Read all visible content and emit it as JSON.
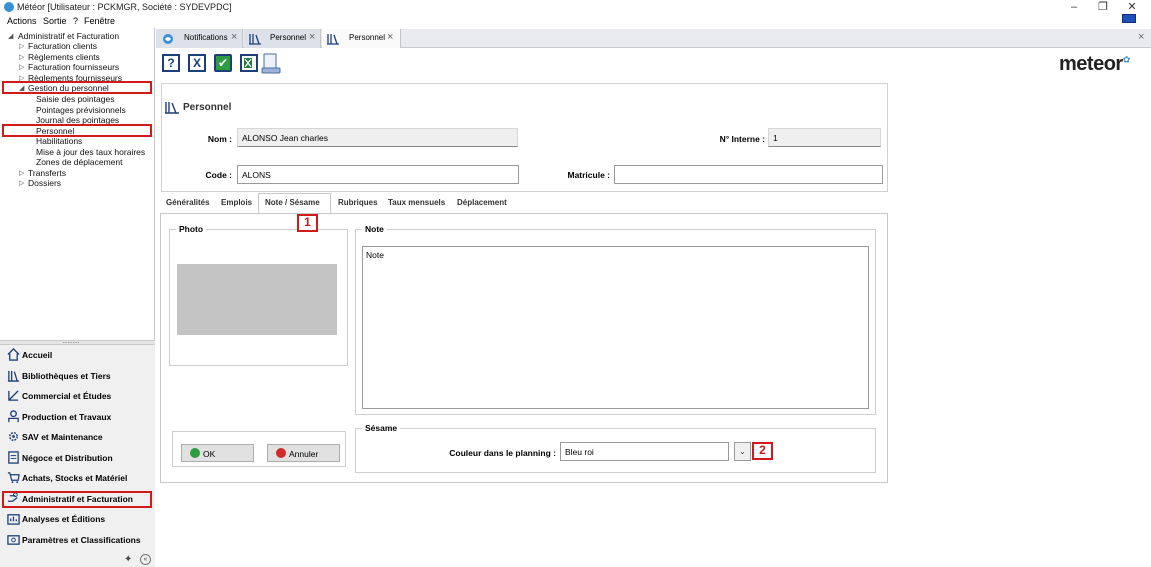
{
  "window": {
    "title": "Météor [Utilisateur : PCKMGR, Société : SYDEVPDC]",
    "minimize_glyph": "–",
    "restore_glyph": "❐",
    "close_glyph": "✕"
  },
  "menu": {
    "items": [
      "Actions",
      "Sortie",
      "?",
      "Fenêtre"
    ]
  },
  "tree": {
    "root": "Administratif et Facturation",
    "children": [
      "Facturation clients",
      "Règlements clients",
      "Facturation fournisseurs",
      "Règlements fournisseurs",
      "Gestion du personnel"
    ],
    "personnel_children": [
      "Saisie des pointages",
      "Pointages prévisionnels",
      "Journal des pointages",
      "Personnel",
      "Habilitations",
      "Mise à jour des taux horaires",
      "Zones de déplacement"
    ],
    "others": [
      "Transferts",
      "Dossiers"
    ]
  },
  "modules": [
    "Accueil",
    "Bibliothèques et Tiers",
    "Commercial et Études",
    "Production et Travaux",
    "SAV et Maintenance",
    "Négoce et Distribution",
    "Achats, Stocks et Matériel",
    "Administratif et Facturation",
    "Analyses et Éditions",
    "Paramètres et Classifications"
  ],
  "doc_tabs": [
    "Notifications",
    "Personnel",
    "Personnel"
  ],
  "toolbar": {
    "help": "?",
    "cancel": "X",
    "validate": "✔"
  },
  "logo": {
    "text": "meteor"
  },
  "form": {
    "section_title": "Personnel",
    "nom_label": "Nom :",
    "nom_value": "ALONSO Jean charles",
    "interne_label": "N° Interne :",
    "interne_value": "1",
    "code_label": "Code :",
    "code_value": "ALONS",
    "matricule_label": "Matricule :",
    "matricule_value": ""
  },
  "subtabs": [
    "Généralités",
    "Emplois",
    "Note / Sésame",
    "Rubriques",
    "Taux mensuels",
    "Déplacement"
  ],
  "photo_group": "Photo",
  "note_group": {
    "title": "Note",
    "value": "Note"
  },
  "sesame": {
    "title": "Sésame",
    "color_label": "Couleur dans le planning :",
    "color_value": "Bleu roi"
  },
  "buttons": {
    "ok": "OK",
    "cancel": "Annuler"
  },
  "markers": [
    "1",
    "2"
  ],
  "colors": {
    "highlight": "#d11a1a",
    "accent": "#1c3f7a",
    "brand_blue": "#3a8fd6"
  }
}
